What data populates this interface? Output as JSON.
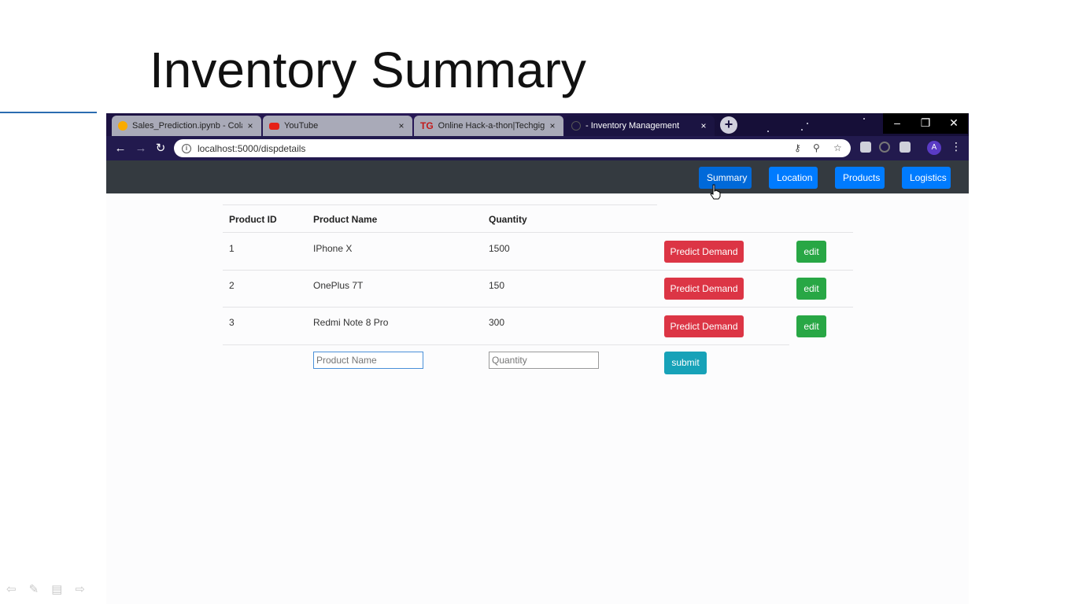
{
  "slide": {
    "title": "Inventory Summary",
    "controls": [
      "⇦",
      "✎",
      "▤",
      "⇨"
    ]
  },
  "browser": {
    "tabs": [
      {
        "label": "Sales_Prediction.ipynb - Colabora",
        "close": "×"
      },
      {
        "label": "YouTube",
        "close": "×"
      },
      {
        "label": "Online Hack-a-thon|Techgig",
        "favicon_text": "TG",
        "close": "×"
      },
      {
        "label": "- Inventory Management",
        "close": "×"
      }
    ],
    "new_tab": "+",
    "window_controls": {
      "minimize": "–",
      "restore": "❐",
      "close": "✕"
    },
    "nav": {
      "back": "←",
      "forward": "→",
      "reload": "↻"
    },
    "url": "localhost:5000/dispdetails",
    "omnibox_icons": {
      "info": "i",
      "key": "⚷",
      "zoom": "⚲",
      "star": "☆"
    },
    "avatar_initial": "A",
    "menu": "⋮"
  },
  "app_nav": {
    "buttons": [
      "Summary",
      "Location",
      "Products",
      "Logistics"
    ]
  },
  "table": {
    "headers": [
      "Product ID",
      "Product Name",
      "Quantity"
    ],
    "rows": [
      {
        "id": "1",
        "name": "IPhone X",
        "qty": "1500",
        "predict": "Predict Demand",
        "edit": "edit"
      },
      {
        "id": "2",
        "name": "OnePlus 7T",
        "qty": "150",
        "predict": "Predict Demand",
        "edit": "edit"
      },
      {
        "id": "3",
        "name": "Redmi Note 8 Pro",
        "qty": "300",
        "predict": "Predict Demand",
        "edit": "edit"
      }
    ],
    "form": {
      "name_placeholder": "Product Name",
      "qty_placeholder": "Quantity",
      "submit_label": "submit"
    }
  },
  "colors": {
    "nav_bg": "#343a40",
    "primary": "#007bff",
    "danger": "#dc3545",
    "success": "#28a745",
    "info": "#17a2b8"
  }
}
